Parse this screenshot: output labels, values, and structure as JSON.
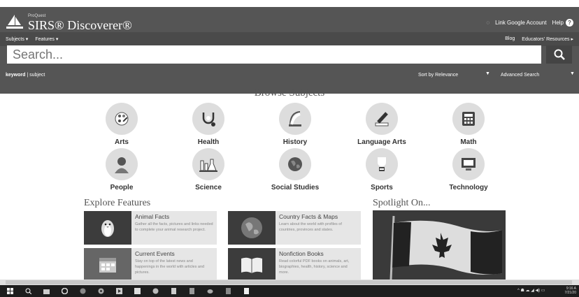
{
  "header": {
    "brand_small": "ProQuest",
    "brand": "SIRS® Discoverer®",
    "link_google": "Link Google Account",
    "help": "Help"
  },
  "nav": {
    "subjects": "Subjects ▾",
    "features": "Features ▾",
    "blog": "Blog",
    "educators": "Educators' Resources ▸"
  },
  "search": {
    "placeholder": "Search...",
    "mode_keyword": "keyword",
    "mode_sep": "|",
    "mode_subject": "subject",
    "sort_label": "Sort by Relevance",
    "advanced": "Advanced Search"
  },
  "browse": {
    "title": "Browse Subjects",
    "subjects": [
      {
        "label": "Arts",
        "icon": "palette-icon"
      },
      {
        "label": "Health",
        "icon": "stethoscope-icon"
      },
      {
        "label": "History",
        "icon": "scroll-icon"
      },
      {
        "label": "Language Arts",
        "icon": "pen-icon"
      },
      {
        "label": "Math",
        "icon": "calculator-icon"
      },
      {
        "label": "People",
        "icon": "person-icon"
      },
      {
        "label": "Science",
        "icon": "lab-icon"
      },
      {
        "label": "Social Studies",
        "icon": "globe-icon"
      },
      {
        "label": "Sports",
        "icon": "trophy-icon"
      },
      {
        "label": "Technology",
        "icon": "monitor-icon"
      }
    ]
  },
  "explore": {
    "title": "Explore Features",
    "items": [
      {
        "title": "Animal Facts",
        "desc": "Gather all the facts, pictures and links needed to complete your animal research project."
      },
      {
        "title": "Country Facts & Maps",
        "desc": "Learn about the world with profiles of countries, provinces and states."
      },
      {
        "title": "Current Events",
        "desc": "Stay on top of the latest news and happenings in the world with articles and pictures."
      },
      {
        "title": "Nonfiction Books",
        "desc": "Read colorful PDF books on animals, art, biographies, health, history, science and more."
      }
    ]
  },
  "spotlight": {
    "title": "Spotlight On..."
  },
  "taskbar": {
    "time": "9:16 A",
    "date": "7/21/20"
  }
}
